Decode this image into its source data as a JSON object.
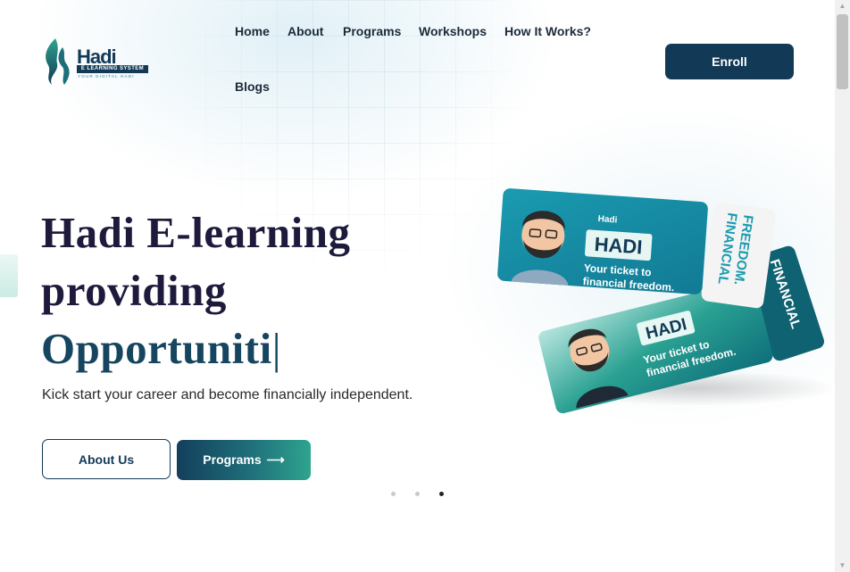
{
  "brand": {
    "name": "Hadi",
    "subtitle": "E LEARNING SYSTEM",
    "tagline": "YOUR DIGITAL HADI",
    "primary_color": "#123a57",
    "accent_color": "#2ea48f"
  },
  "nav": {
    "items": [
      {
        "label": "Home"
      },
      {
        "label": "About"
      },
      {
        "label": "Programs"
      },
      {
        "label": "Workshops"
      },
      {
        "label": "How It Works?"
      },
      {
        "label": "Blogs"
      }
    ],
    "enroll_label": "Enroll"
  },
  "hero": {
    "title_line1": "Hadi E-learning",
    "title_line2": "providing",
    "title_typed": "Opportuniti",
    "cursor": "|",
    "subtitle": "Kick start your career and become financially independent.",
    "about_button": "About Us",
    "programs_button": "Programs",
    "programs_arrow": "⟶"
  },
  "carousel": {
    "slide_count": 3,
    "active_index": 2
  },
  "tickets_image": {
    "badge": "HADI",
    "line1": "Your ticket to",
    "line2": "financial freedom.",
    "stub1": "FINANCIAL",
    "stub2": "FREEDOM.",
    "logo": "Hadi"
  }
}
